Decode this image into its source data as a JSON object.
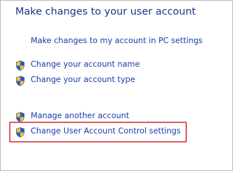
{
  "header": {
    "title": "Make changes to your user account"
  },
  "links": {
    "pc_settings": "Make changes to my account in PC settings",
    "change_name": "Change your account name",
    "change_type": "Change your account type",
    "manage_another": "Manage another account",
    "uac_settings": "Change User Account Control settings"
  },
  "icons": {
    "shield": "uac-shield-icon"
  },
  "colors": {
    "link": "#1a3aaa",
    "title": "#1e3287",
    "highlight_border": "#e0565a",
    "frame_border": "#b9b9b9"
  }
}
